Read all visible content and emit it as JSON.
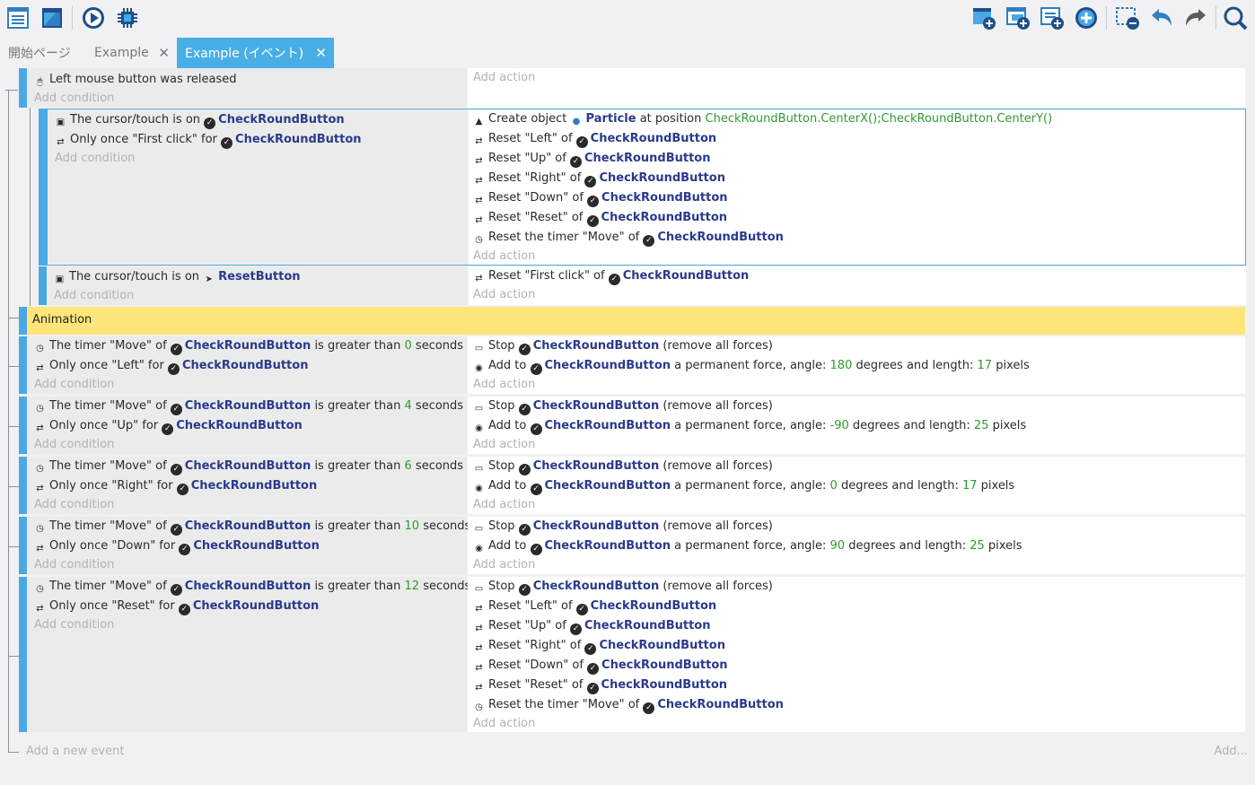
{
  "toolbar": {
    "left_icons": [
      "events-list-icon",
      "window-icon",
      "play-icon",
      "debugger-chip-icon"
    ],
    "right_icons": [
      "add-event-icon",
      "add-subevent-icon",
      "add-comment-icon",
      "add-more-icon",
      "delete-event-icon",
      "undo-icon",
      "redo-icon",
      "search-icon"
    ]
  },
  "tabs": [
    {
      "label": "開始ページ",
      "active": false,
      "closable": false
    },
    {
      "label": "Example",
      "active": false,
      "closable": true
    },
    {
      "label": "Example (イベント)",
      "active": true,
      "closable": true
    }
  ],
  "colors": {
    "accent": "#4aa9e4",
    "group": "#ffe57a",
    "object": "#2a3a8c",
    "number": "#2f9a2f"
  },
  "labels": {
    "add_condition": "Add condition",
    "add_action": "Add action",
    "add_new_event": "Add a new event",
    "add_more": "Add..."
  },
  "event1": {
    "cond": "Left mouse button was released"
  },
  "event2": {
    "c1": {
      "pre": "The cursor/touch is on",
      "obj": "CheckRoundButton"
    },
    "c2": {
      "pre": "Only once \"First click\" for",
      "obj": "CheckRoundButton"
    },
    "a1": {
      "pre": "Create object",
      "obj": "Particle",
      "mid": "at position",
      "expr": "CheckRoundButton.CenterX();CheckRoundButton.CenterY()"
    },
    "a2": {
      "pre": "Reset \"Left\" of",
      "obj": "CheckRoundButton"
    },
    "a3": {
      "pre": "Reset \"Up\" of",
      "obj": "CheckRoundButton"
    },
    "a4": {
      "pre": "Reset \"Right\" of",
      "obj": "CheckRoundButton"
    },
    "a5": {
      "pre": "Reset \"Down\" of",
      "obj": "CheckRoundButton"
    },
    "a6": {
      "pre": "Reset \"Reset\" of",
      "obj": "CheckRoundButton"
    },
    "a7": {
      "pre": "Reset the timer \"Move\" of",
      "obj": "CheckRoundButton"
    }
  },
  "event3": {
    "c1": {
      "pre": "The cursor/touch is on",
      "obj": "ResetButton"
    },
    "a1": {
      "pre": "Reset \"First click\" of",
      "obj": "CheckRoundButton"
    }
  },
  "group": {
    "label": "Animation"
  },
  "anim": [
    {
      "c1_pre": "The timer \"Move\" of",
      "c1_obj": "CheckRoundButton",
      "c1_mid": "is greater than",
      "c1_num": "0",
      "c1_post": "seconds",
      "c2_pre": "Only once \"Left\" for",
      "c2_obj": "CheckRoundButton",
      "a1_pre": "Stop",
      "a1_obj": "CheckRoundButton",
      "a1_post": "(remove all forces)",
      "a2_pre": "Add to",
      "a2_obj": "CheckRoundButton",
      "a2_mid": "a permanent force, angle:",
      "a2_angle": "180",
      "a2_mid2": "degrees and length:",
      "a2_len": "17",
      "a2_post": "pixels"
    },
    {
      "c1_pre": "The timer \"Move\" of",
      "c1_obj": "CheckRoundButton",
      "c1_mid": "is greater than",
      "c1_num": "4",
      "c1_post": "seconds",
      "c2_pre": "Only once \"Up\" for",
      "c2_obj": "CheckRoundButton",
      "a1_pre": "Stop",
      "a1_obj": "CheckRoundButton",
      "a1_post": "(remove all forces)",
      "a2_pre": "Add to",
      "a2_obj": "CheckRoundButton",
      "a2_mid": "a permanent force, angle:",
      "a2_angle": "-90",
      "a2_mid2": "degrees and length:",
      "a2_len": "25",
      "a2_post": "pixels"
    },
    {
      "c1_pre": "The timer \"Move\" of",
      "c1_obj": "CheckRoundButton",
      "c1_mid": "is greater than",
      "c1_num": "6",
      "c1_post": "seconds",
      "c2_pre": "Only once \"Right\" for",
      "c2_obj": "CheckRoundButton",
      "a1_pre": "Stop",
      "a1_obj": "CheckRoundButton",
      "a1_post": "(remove all forces)",
      "a2_pre": "Add to",
      "a2_obj": "CheckRoundButton",
      "a2_mid": "a permanent force, angle:",
      "a2_angle": "0",
      "a2_mid2": "degrees and length:",
      "a2_len": "17",
      "a2_post": "pixels"
    },
    {
      "c1_pre": "The timer \"Move\" of",
      "c1_obj": "CheckRoundButton",
      "c1_mid": "is greater than",
      "c1_num": "10",
      "c1_post": "seconds",
      "c2_pre": "Only once \"Down\" for",
      "c2_obj": "CheckRoundButton",
      "a1_pre": "Stop",
      "a1_obj": "CheckRoundButton",
      "a1_post": "(remove all forces)",
      "a2_pre": "Add to",
      "a2_obj": "CheckRoundButton",
      "a2_mid": "a permanent force, angle:",
      "a2_angle": "90",
      "a2_mid2": "degrees and length:",
      "a2_len": "25",
      "a2_post": "pixels"
    }
  ],
  "event_last": {
    "c1_pre": "The timer \"Move\" of",
    "c1_obj": "CheckRoundButton",
    "c1_mid": "is greater than",
    "c1_num": "12",
    "c1_post": "seconds",
    "c2_pre": "Only once \"Reset\" for",
    "c2_obj": "CheckRoundButton",
    "a1_pre": "Stop",
    "a1_obj": "CheckRoundButton",
    "a1_post": "(remove all forces)",
    "a2": {
      "pre": "Reset \"Left\" of",
      "obj": "CheckRoundButton"
    },
    "a3": {
      "pre": "Reset \"Up\" of",
      "obj": "CheckRoundButton"
    },
    "a4": {
      "pre": "Reset \"Right\" of",
      "obj": "CheckRoundButton"
    },
    "a5": {
      "pre": "Reset \"Down\" of",
      "obj": "CheckRoundButton"
    },
    "a6": {
      "pre": "Reset \"Reset\" of",
      "obj": "CheckRoundButton"
    },
    "a7": {
      "pre": "Reset the timer \"Move\" of",
      "obj": "CheckRoundButton"
    }
  }
}
